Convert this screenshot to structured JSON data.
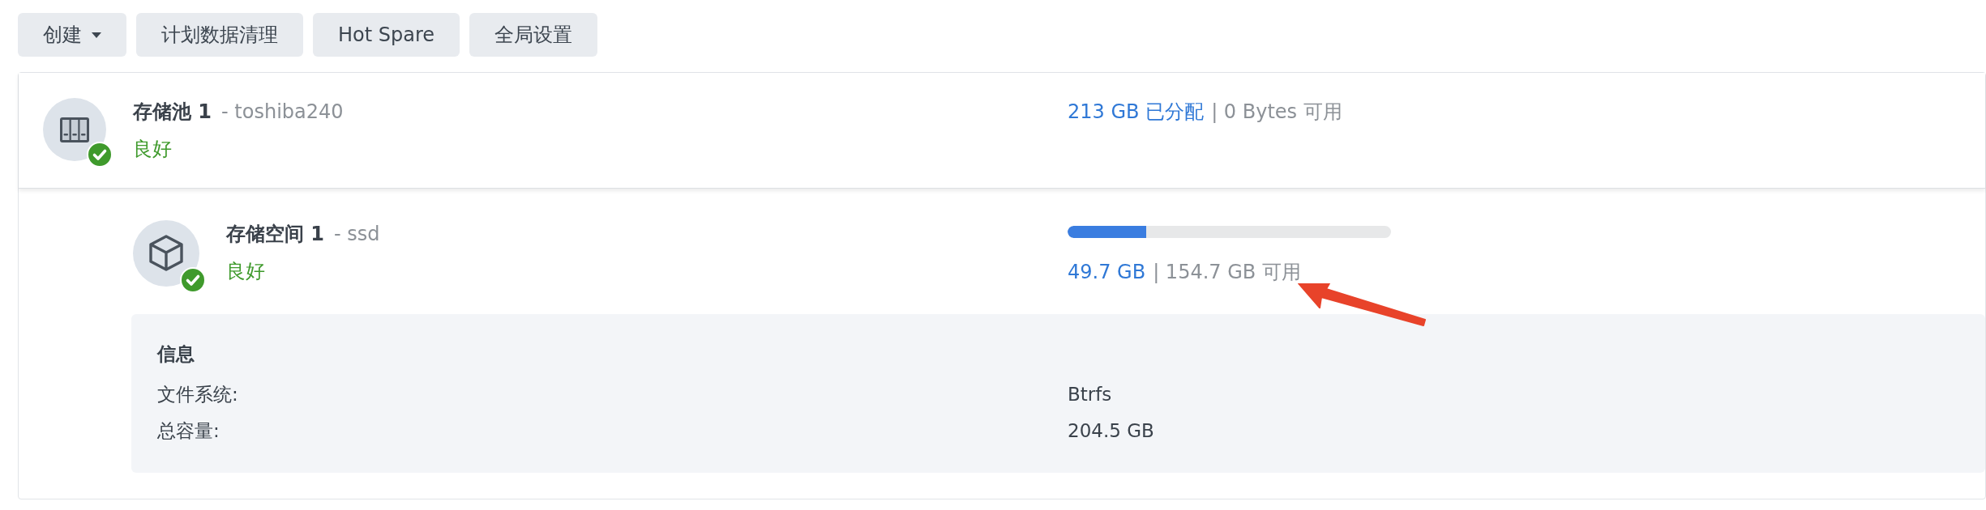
{
  "toolbar": {
    "buttons": [
      {
        "label": "创建",
        "kind": "dropdown"
      },
      {
        "label": "计划数据清理",
        "kind": "plain"
      },
      {
        "label": "Hot Spare",
        "kind": "plain"
      },
      {
        "label": "全局设置",
        "kind": "plain"
      }
    ]
  },
  "pool": {
    "name": "存储池 1",
    "suffix": "- toshiba240",
    "status": {
      "text": "良好",
      "kind": "healthy"
    },
    "used": "213 GB 已分配",
    "rest": "| 0 Bytes 可用"
  },
  "volume": {
    "name": "存储空间 1",
    "suffix": "- ssd",
    "status": {
      "text": "良好",
      "kind": "healthy"
    },
    "level": 0.243,
    "used": "49.7 GB",
    "rest": "| 154.7 GB 可用"
  },
  "info": {
    "title": "信息",
    "rows": [
      {
        "label": "文件系统:",
        "value": "Btrfs"
      },
      {
        "label": "总容量:",
        "value": "204.5 GB"
      }
    ]
  }
}
